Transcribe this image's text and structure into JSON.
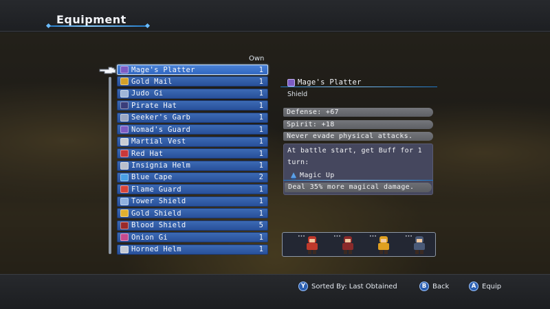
{
  "header": {
    "title": "Equipment"
  },
  "list": {
    "own_label": "Own",
    "items": [
      {
        "name": "Mage's Platter",
        "qty": "1",
        "icon": "shield-icon",
        "color": "#7c5cc4",
        "selected": true
      },
      {
        "name": "Gold Mail",
        "qty": "1",
        "icon": "armor-icon",
        "color": "#d4a12a"
      },
      {
        "name": "Judo Gi",
        "qty": "1",
        "icon": "gi-icon",
        "color": "#9fb6d8"
      },
      {
        "name": "Pirate Hat",
        "qty": "1",
        "icon": "hat-icon",
        "color": "#3a3d7a"
      },
      {
        "name": "Seeker's Garb",
        "qty": "1",
        "icon": "garb-icon",
        "color": "#9aa7c4"
      },
      {
        "name": "Nomad's Guard",
        "qty": "1",
        "icon": "shield-icon",
        "color": "#7c5cc4"
      },
      {
        "name": "Martial Vest",
        "qty": "1",
        "icon": "vest-icon",
        "color": "#c9ccd2"
      },
      {
        "name": "Red Hat",
        "qty": "1",
        "icon": "hat-icon",
        "color": "#c8383a"
      },
      {
        "name": "Insignia Helm",
        "qty": "1",
        "icon": "helm-icon",
        "color": "#b9bfcb"
      },
      {
        "name": "Blue Cape",
        "qty": "2",
        "icon": "cape-icon",
        "color": "#4aa0e6"
      },
      {
        "name": "Flame Guard",
        "qty": "1",
        "icon": "shield-icon",
        "color": "#d8443a"
      },
      {
        "name": "Tower Shield",
        "qty": "1",
        "icon": "shield-icon",
        "color": "#8fb1e0"
      },
      {
        "name": "Gold Shield",
        "qty": "1",
        "icon": "shield-icon",
        "color": "#e0b030"
      },
      {
        "name": "Blood Shield",
        "qty": "5",
        "icon": "shield-icon",
        "color": "#9a2a2a"
      },
      {
        "name": "Onion Gi",
        "qty": "1",
        "icon": "gi-icon",
        "color": "#c54a8e"
      },
      {
        "name": "Horned Helm",
        "qty": "1",
        "icon": "helm-icon",
        "color": "#c4c9d3"
      }
    ]
  },
  "detail": {
    "name": "Mage's Platter",
    "type": "Shield",
    "stats": [
      "Defense:  +67",
      "Spirit:  +18",
      "Never evade physical attacks."
    ],
    "effect_text": "At battle start, get Buff for 1 turn:",
    "effect_name": "Magic Up",
    "effect_desc": "Deal 35% more magical damage."
  },
  "footer": {
    "sort_key": "Y",
    "sort_label": "Sorted By: Last Obtained",
    "back_key": "B",
    "back_label": "Back",
    "equip_key": "A",
    "equip_label": "Equip"
  },
  "party_colors": [
    "#c0392b",
    "#8a2a2a",
    "#e0a020",
    "#4a5a78"
  ]
}
